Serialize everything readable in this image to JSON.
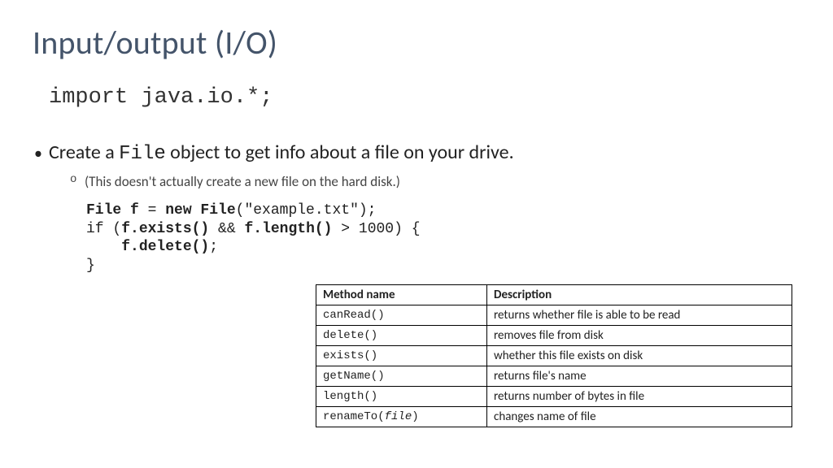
{
  "title": "Input/output (I/O)",
  "import_line": "import java.io.*;",
  "bullet_pre": "Create a ",
  "bullet_code": "File",
  "bullet_post": " object to get info about a file on your drive.",
  "sub_note": "(This doesn't actually create a new file on the hard disk.)",
  "code": {
    "l1a": "File f",
    "l1b": " = ",
    "l1c": "new File",
    "l1d": "(\"example.txt\");",
    "l2a": "if (",
    "l2b": "f.exists()",
    "l2c": " && ",
    "l2d": "f.length()",
    "l2e": " > 1000) {",
    "l3a": "    ",
    "l3b": "f.delete()",
    "l3c": ";",
    "l4": "}"
  },
  "table": {
    "h1": "Method name",
    "h2": "Description",
    "rows": [
      {
        "m": "canRead()",
        "d": "returns whether file is able to be read"
      },
      {
        "m": "delete()",
        "d": "removes file from disk"
      },
      {
        "m": "exists()",
        "d": "whether this file exists on disk"
      },
      {
        "m": "getName()",
        "d": "returns file's name"
      },
      {
        "m": "length()",
        "d": "returns number of bytes in file"
      },
      {
        "m_pre": "renameTo(",
        "m_ital": "file",
        "m_post": ")",
        "d": "changes name of file"
      }
    ]
  }
}
